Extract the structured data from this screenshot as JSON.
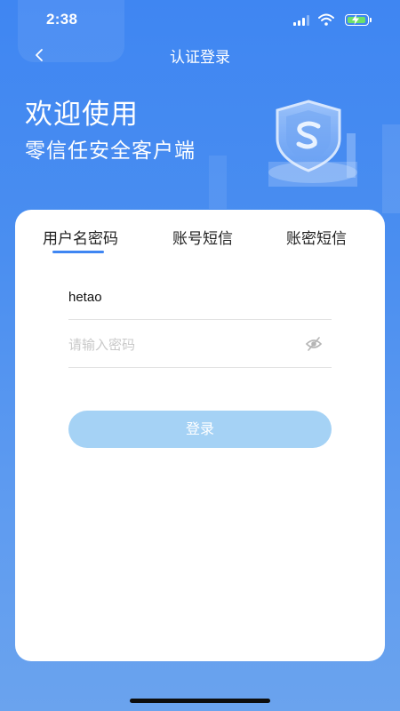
{
  "status_bar": {
    "time": "2:38"
  },
  "header": {
    "title": "认证登录"
  },
  "welcome": {
    "title": "欢迎使用",
    "subtitle": "零信任安全客户端"
  },
  "tabs": [
    {
      "label": "用户名密码",
      "active": true
    },
    {
      "label": "账号短信",
      "active": false
    },
    {
      "label": "账密短信",
      "active": false
    }
  ],
  "form": {
    "username_value": "hetao",
    "password_placeholder": "请输入密码",
    "login_label": "登录"
  },
  "colors": {
    "accent": "#3f86f2",
    "button_disabled": "#a5d2f5",
    "battery": "#6ee06a"
  }
}
